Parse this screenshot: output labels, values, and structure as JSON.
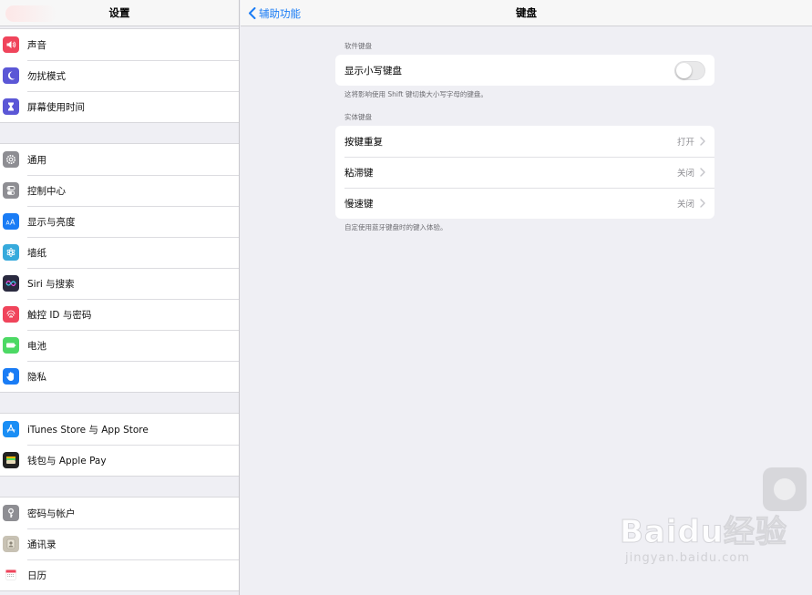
{
  "sidebar": {
    "title": "设置",
    "groups": [
      [
        {
          "label": "声音",
          "icon": "speaker-icon",
          "color": "#f0445b"
        },
        {
          "label": "勿扰模式",
          "icon": "moon-icon",
          "color": "#5b57d6"
        },
        {
          "label": "屏幕使用时间",
          "icon": "hourglass-icon",
          "color": "#5b57d6"
        }
      ],
      [
        {
          "label": "通用",
          "icon": "gear-icon",
          "color": "#8e8e93"
        },
        {
          "label": "控制中心",
          "icon": "switches-icon",
          "color": "#8e8e93"
        },
        {
          "label": "显示与亮度",
          "icon": "text-size-icon",
          "color": "#1a7cf5"
        },
        {
          "label": "墙纸",
          "icon": "flower-icon",
          "color": "#36aadc"
        },
        {
          "label": "Siri 与搜索",
          "icon": "siri-icon",
          "color": "#2a2a40"
        },
        {
          "label": "触控 ID 与密码",
          "icon": "fingerprint-icon",
          "color": "#f0445b"
        },
        {
          "label": "电池",
          "icon": "battery-icon",
          "color": "#4cd964"
        },
        {
          "label": "隐私",
          "icon": "hand-icon",
          "color": "#1a7cf5"
        }
      ],
      [
        {
          "label": "iTunes Store 与 App Store",
          "icon": "app-store-icon",
          "color": "#1a8ef5"
        },
        {
          "label": "钱包与 Apple Pay",
          "icon": "wallet-icon",
          "color": "#222222"
        }
      ],
      [
        {
          "label": "密码与帐户",
          "icon": "key-icon",
          "color": "#8e8e93"
        },
        {
          "label": "通讯录",
          "icon": "contacts-icon",
          "color": "#c8c2b4"
        },
        {
          "label": "日历",
          "icon": "calendar-icon",
          "color": "#ffffff"
        }
      ]
    ]
  },
  "nav": {
    "back_label": "辅助功能",
    "title": "键盘"
  },
  "software_keyboard": {
    "header": "软件键盘",
    "row_label": "显示小写键盘",
    "toggle_on": false,
    "footer": "这将影响使用 Shift 键切换大小写字母的键盘。"
  },
  "hardware_keyboard": {
    "header": "实体键盘",
    "rows": [
      {
        "label": "按键重复",
        "value": "打开"
      },
      {
        "label": "粘滞键",
        "value": "关闭"
      },
      {
        "label": "慢速键",
        "value": "关闭"
      }
    ],
    "footer": "自定使用蓝牙键盘时的键入体验。"
  },
  "watermark": {
    "main": "Baidu经验",
    "sub": "jingyan.baidu.com"
  },
  "colors": {
    "accent": "#1a7cf5",
    "background": "#efeff4"
  }
}
